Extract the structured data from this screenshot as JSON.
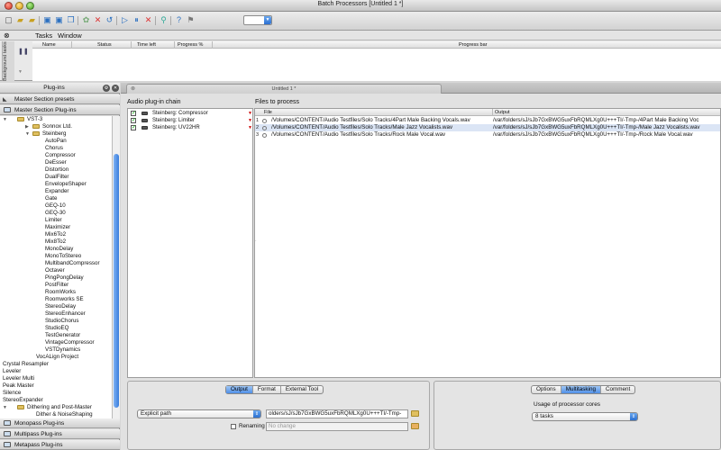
{
  "window": {
    "title": "Batch Processors [Untitled 1 *]"
  },
  "toolbar": {
    "icons": [
      "new-icon",
      "open-icon",
      "open-recent-icon",
      "save-icon",
      "save-as-icon",
      "copy-icon",
      "clear-icon",
      "delete-icon",
      "undo-icon",
      "play-icon",
      "pause-icon",
      "stop-icon",
      "filter-icon",
      "help-icon",
      "pin-icon"
    ]
  },
  "tasks": {
    "menu": [
      "Tasks",
      "Window"
    ],
    "side_label": "Background tasks",
    "columns": [
      "Name",
      "Status",
      "Time left",
      "Progress %",
      "Progress bar"
    ]
  },
  "sidebar": {
    "title": "Plug-ins",
    "sections_top": [
      "Master Section presets",
      "Master Section Plug-ins"
    ],
    "tree": [
      {
        "label": "VST-3",
        "level": 0,
        "folder": true,
        "expanded": true
      },
      {
        "label": "Sonnox Ltd.",
        "level": 1,
        "folder": true,
        "expanded": false
      },
      {
        "label": "Steinberg",
        "level": 1,
        "folder": true,
        "expanded": true
      },
      {
        "label": "AutoPan",
        "level": 2
      },
      {
        "label": "Chorus",
        "level": 2
      },
      {
        "label": "Compressor",
        "level": 2
      },
      {
        "label": "DeEsser",
        "level": 2
      },
      {
        "label": "Distortion",
        "level": 2
      },
      {
        "label": "DualFilter",
        "level": 2
      },
      {
        "label": "EnvelopeShaper",
        "level": 2
      },
      {
        "label": "Expander",
        "level": 2
      },
      {
        "label": "Gate",
        "level": 2
      },
      {
        "label": "GEQ-10",
        "level": 2
      },
      {
        "label": "GEQ-30",
        "level": 2
      },
      {
        "label": "Limiter",
        "level": 2
      },
      {
        "label": "Maximizer",
        "level": 2
      },
      {
        "label": "Mix6To2",
        "level": 2
      },
      {
        "label": "Mix8To2",
        "level": 2
      },
      {
        "label": "MonoDelay",
        "level": 2
      },
      {
        "label": "MonoToStereo",
        "level": 2
      },
      {
        "label": "MultibandCompressor",
        "level": 2
      },
      {
        "label": "Octaver",
        "level": 2
      },
      {
        "label": "PingPongDelay",
        "level": 2
      },
      {
        "label": "PostFilter",
        "level": 2
      },
      {
        "label": "RoomWorks",
        "level": 2
      },
      {
        "label": "Roomworks SE",
        "level": 2
      },
      {
        "label": "StereoDelay",
        "level": 2
      },
      {
        "label": "StereoEnhancer",
        "level": 2
      },
      {
        "label": "StudioChorus",
        "level": 2
      },
      {
        "label": "StudioEQ",
        "level": 2
      },
      {
        "label": "TestGenerator",
        "level": 2
      },
      {
        "label": "VintageCompressor",
        "level": 2
      },
      {
        "label": "VSTDynamics",
        "level": 2
      },
      {
        "label": "VocALign Project",
        "level": 1
      },
      {
        "label": "Crystal Resampler",
        "level": 0
      },
      {
        "label": "Leveler",
        "level": 0
      },
      {
        "label": "Leveler Multi",
        "level": 0
      },
      {
        "label": "Peak Master",
        "level": 0
      },
      {
        "label": "Silence",
        "level": 0
      },
      {
        "label": "StereoExpander",
        "level": 0
      },
      {
        "label": "Dithering and Post-Master",
        "level": 0,
        "folder": true,
        "expanded": true
      },
      {
        "label": "Dither & NoiseShaping",
        "level": 1
      },
      {
        "label": "Steinberg: UV22HR",
        "level": 1,
        "selected": true
      }
    ],
    "sections_bottom": [
      "Monopass Plug-ins",
      "Multipass Plug-ins",
      "Metapass Plug-ins"
    ]
  },
  "main_tab": {
    "label": "Untitled 1 *"
  },
  "chain": {
    "title": "Audio plug-in chain",
    "items": [
      {
        "label": "Steinberg: Compressor",
        "checked": true
      },
      {
        "label": "Steinberg: Limiter",
        "checked": true
      },
      {
        "label": "Steinberg: UV22HR",
        "checked": true
      }
    ]
  },
  "files": {
    "title": "Files to process",
    "columns": [
      "File",
      "Output"
    ],
    "rows": [
      {
        "n": "1",
        "file": "/Volumes/CONTENT/Audio Testfiles/Solo Tracks/4Part Male Backing Vocals.wav",
        "output": "/var/folders/sJ/sJb7GxBWG5uxFbRQMLXg0U+++TI/-Tmp-/4Part Male Backing Voc"
      },
      {
        "n": "2",
        "file": "/Volumes/CONTENT/Audio Testfiles/Solo Tracks/Male Jazz Vocalists.wav",
        "output": "/var/folders/sJ/sJb7GxBWG5uxFbRQMLXg0U+++TI/-Tmp-/Male Jazz Vocalists.wav",
        "selected": true
      },
      {
        "n": "3",
        "file": "/Volumes/CONTENT/Audio Testfiles/Solo Tracks/Rock Male Vocal.wav",
        "output": "/var/folders/sJ/sJb7GxBWG5uxFbRQMLXg0U+++TI/-Tmp-/Rock Male Vocal.wav"
      }
    ]
  },
  "output_panel": {
    "tabs": [
      "Output",
      "Format",
      "External Tool"
    ],
    "active_tab": "Output",
    "path_mode": "Explicit path",
    "path_value": "olders/sJ/sJb7GxBWG5uxFbRQMLXg0U+++TI/-Tmp-",
    "renaming_label": "Renaming",
    "renaming_value": "No change"
  },
  "options_panel": {
    "tabs": [
      "Options",
      "Multitasking",
      "Comment"
    ],
    "active_tab": "Multitasking",
    "cores_label": "Usage of processor cores",
    "cores_value": "8 tasks"
  },
  "colors": {
    "selection": "#2f6fd2",
    "accent": "#4f8ee6"
  }
}
